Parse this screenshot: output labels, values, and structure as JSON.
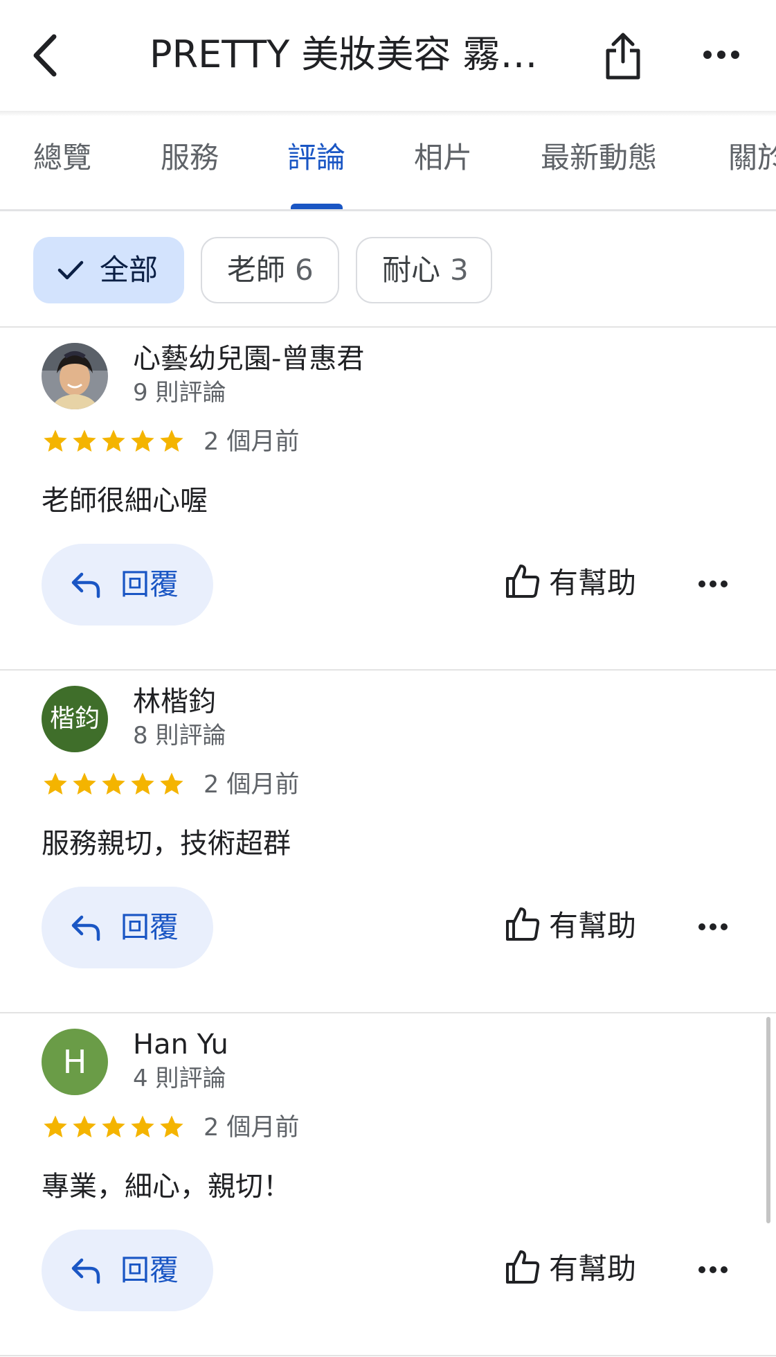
{
  "header": {
    "title": "PRETTY 美妝美容 霧…",
    "back_icon": "chevron-left-icon",
    "share_icon": "share-icon",
    "more_icon": "more-horizontal-icon"
  },
  "tabs": [
    {
      "label": "總覽",
      "active": false
    },
    {
      "label": "服務",
      "active": false
    },
    {
      "label": "評論",
      "active": true
    },
    {
      "label": "相片",
      "active": false
    },
    {
      "label": "最新動態",
      "active": false
    },
    {
      "label": "關於",
      "active": false
    }
  ],
  "filters": [
    {
      "label": "全部",
      "count": "",
      "selected": true
    },
    {
      "label": "老師",
      "count": "6",
      "selected": false
    },
    {
      "label": "耐心",
      "count": "3",
      "selected": false
    }
  ],
  "reviews": [
    {
      "name": "心藝幼兒園-曾惠君",
      "review_count": "9 則評論",
      "rating": 5,
      "date": "2 個月前",
      "text": "老師很細心喔",
      "avatar": {
        "type": "photo",
        "initial": "",
        "color": "#c9a57e"
      },
      "reply_label": "回覆",
      "helpful_label": "有幫助"
    },
    {
      "name": "林楷鈞",
      "review_count": "8 則評論",
      "rating": 5,
      "date": "2 個月前",
      "text": "服務親切，技術超群",
      "avatar": {
        "type": "initials",
        "initial": "楷鈞",
        "color": "#3f6e2a"
      },
      "reply_label": "回覆",
      "helpful_label": "有幫助"
    },
    {
      "name": "Han Yu",
      "review_count": "4 則評論",
      "rating": 5,
      "date": "2 個月前",
      "text": "專業，細心，親切！",
      "avatar": {
        "type": "initials",
        "initial": "H",
        "color": "#6a9c47"
      },
      "reply_label": "回覆",
      "helpful_label": "有幫助"
    }
  ],
  "colors": {
    "accent": "#1a56c4",
    "chip_selected_bg": "#d3e3fd",
    "reply_bg": "#e9effc",
    "star": "#f4b400"
  }
}
